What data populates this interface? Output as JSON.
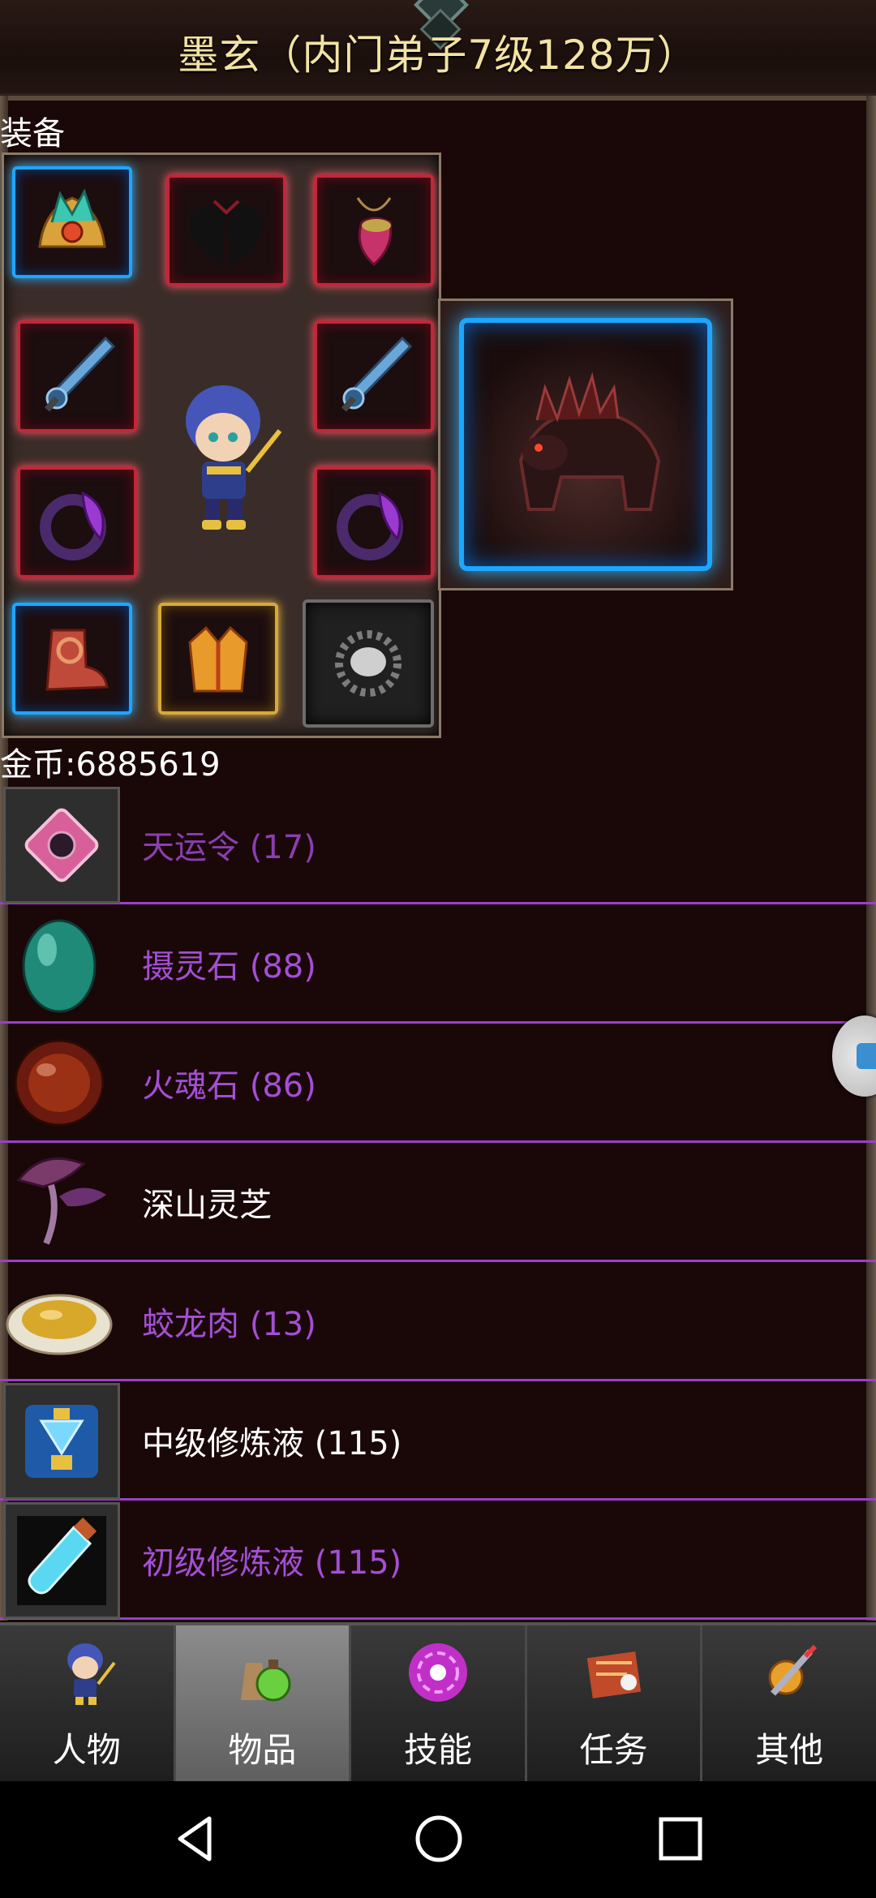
{
  "header": {
    "title": "墨玄（内门弟子7级128万）"
  },
  "equipment": {
    "label": "装备",
    "slots": [
      {
        "id": "helmet",
        "icon": "helmet-icon"
      },
      {
        "id": "wings",
        "icon": "wings-icon"
      },
      {
        "id": "amulet",
        "icon": "amulet-icon"
      },
      {
        "id": "weapon-left",
        "icon": "sword-icon"
      },
      {
        "id": "weapon-right",
        "icon": "sword-icon"
      },
      {
        "id": "ring-left",
        "icon": "ring-icon"
      },
      {
        "id": "ring-right",
        "icon": "ring-icon"
      },
      {
        "id": "boots",
        "icon": "boots-icon"
      },
      {
        "id": "armor",
        "icon": "armor-icon"
      },
      {
        "id": "bead",
        "icon": "bead-icon"
      }
    ],
    "mount_icon": "beast-mount-icon"
  },
  "gold": {
    "label": "金币:",
    "value": "6885619"
  },
  "items": [
    {
      "name": "天运令 (17)",
      "icon": "token-icon",
      "color": "dim"
    },
    {
      "name": "摄灵石 (88)",
      "icon": "green-stone-icon",
      "color": "purple"
    },
    {
      "name": "火魂石 (86)",
      "icon": "red-stone-icon",
      "color": "purple"
    },
    {
      "name": "深山灵芝",
      "icon": "lingzhi-icon",
      "color": "white"
    },
    {
      "name": "蛟龙肉 (13)",
      "icon": "dragon-meat-icon",
      "color": "purple"
    },
    {
      "name": "中级修炼液 (115)",
      "icon": "potion-flask-icon",
      "color": "white"
    },
    {
      "name": "初级修炼液 (115)",
      "icon": "test-tube-icon",
      "color": "purple"
    }
  ],
  "tabs": [
    {
      "label": "人物",
      "icon": "character-icon",
      "active": false
    },
    {
      "label": "物品",
      "icon": "potion-bag-icon",
      "active": true
    },
    {
      "label": "技能",
      "icon": "skill-orb-icon",
      "active": false
    },
    {
      "label": "任务",
      "icon": "quest-icon",
      "active": false
    },
    {
      "label": "其他",
      "icon": "other-icon",
      "active": false
    }
  ],
  "colors": {
    "background": "#1a0708",
    "item_purple": "#a44fd6",
    "divider": "#9a40c8",
    "title_gold": "#f3e3a3"
  }
}
